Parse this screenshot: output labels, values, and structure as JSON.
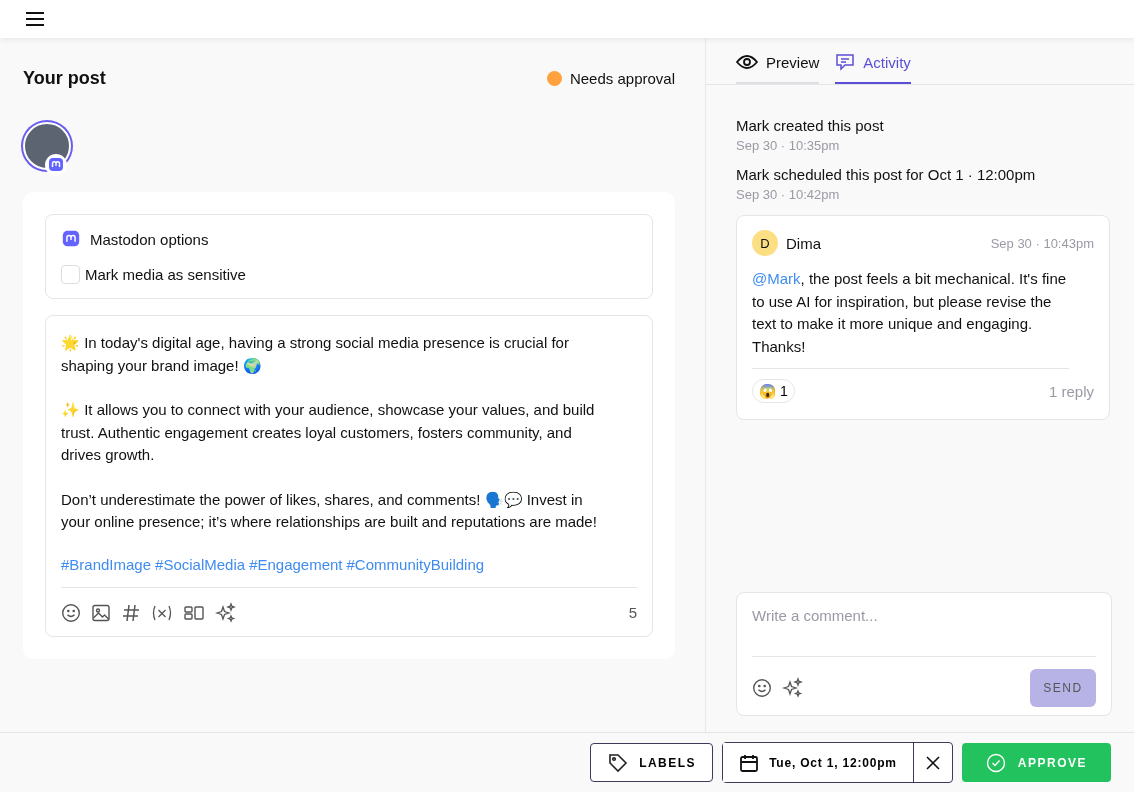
{
  "post": {
    "title": "Your post",
    "status": {
      "label": "Needs approval",
      "color": "#ffa23e"
    },
    "options": {
      "title": "Mastodon options",
      "checkbox": {
        "label": "Mark media as sensitive",
        "checked": false
      }
    },
    "paragraphs": [
      "🌟 In today's digital age, having a strong social media presence is crucial for shaping your brand image! 🌍",
      "✨ It allows you to connect with your audience, showcase your values, and build trust. Authentic engagement creates loyal customers, fosters community, and drives growth.",
      "Don’t underestimate the power of likes, shares, and comments! 🗣️💬 Invest in your online presence; it’s where relationships are built and reputations are made!"
    ],
    "hashtags": [
      "#BrandImage",
      "#SocialMedia",
      "#Engagement",
      "#CommunityBuilding"
    ],
    "count": "5"
  },
  "tabs": [
    {
      "label": "Preview",
      "selected": false
    },
    {
      "label": "Activity",
      "selected": true
    }
  ],
  "activity": [
    {
      "text": "Mark created this post",
      "time": "Sep 30 · 10:35pm"
    },
    {
      "text": "Mark scheduled this post for Oct 1 · 12:00pm",
      "time": "Sep 30 · 10:42pm"
    }
  ],
  "comment": {
    "initial": "D",
    "author": "Dima",
    "time": "Sep 30 · 10:43pm",
    "mention": "@Mark",
    "text": ", the post feels a bit mechanical. It's fine to use AI for inspiration, but please revise the text to make it more unique and engaging. Thanks!",
    "reaction": {
      "emoji": "😱",
      "count": "1"
    },
    "replies": "1 reply"
  },
  "composer": {
    "placeholder": "Write a comment...",
    "send": {
      "label": "SEND",
      "disabled": true
    }
  },
  "footer": {
    "labels": "LABELS",
    "date": "Tue, Oct 1, 12:00pm",
    "approve": "APPROVE"
  }
}
